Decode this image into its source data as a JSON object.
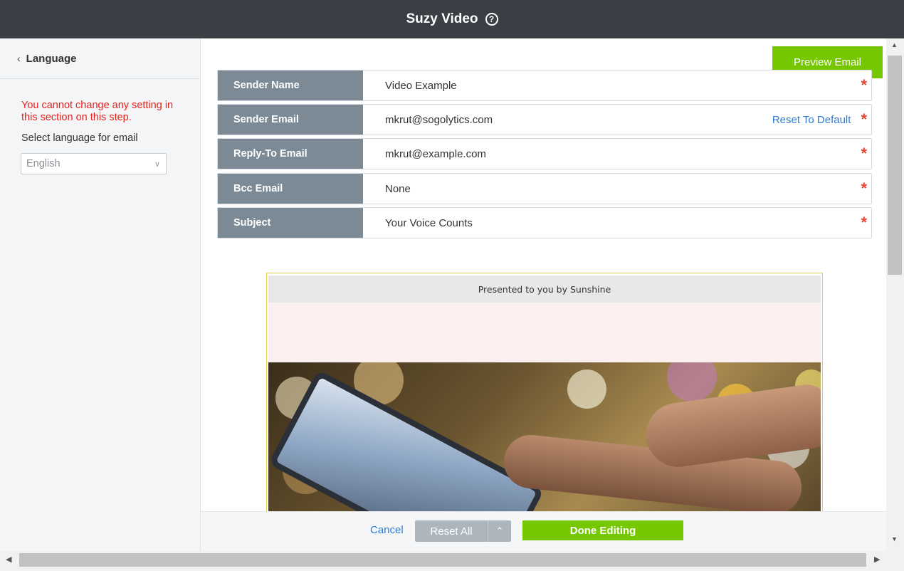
{
  "app": {
    "title": "Suzy Video",
    "help_icon": "?"
  },
  "sidebar": {
    "back_label": "Language",
    "warning": "You cannot change any setting in this section on this step.",
    "select_label": "Select language for email",
    "language_value": "English"
  },
  "toolbar": {
    "preview_label": "Preview Email"
  },
  "fields": [
    {
      "label": "Sender Name",
      "value": "Video Example"
    },
    {
      "label": "Sender Email",
      "value": "mkrut@sogolytics.com",
      "action": "Reset To Default"
    },
    {
      "label": "Reply-To Email",
      "value": "mkrut@example.com"
    },
    {
      "label": "Bcc Email",
      "value": "None"
    },
    {
      "label": "Subject",
      "value": "Your Voice Counts"
    }
  ],
  "email_preview": {
    "header_text": "Presented to you by Sunshine"
  },
  "footer": {
    "cancel": "Cancel",
    "reset_all": "Reset All",
    "done": "Done Editing"
  },
  "colors": {
    "accent_green": "#75c800",
    "link_blue": "#2e7cd6",
    "label_gray": "#7b8a95",
    "required_red": "#e64637",
    "warning_red": "#e8211c",
    "topbar": "#3a3e45"
  }
}
